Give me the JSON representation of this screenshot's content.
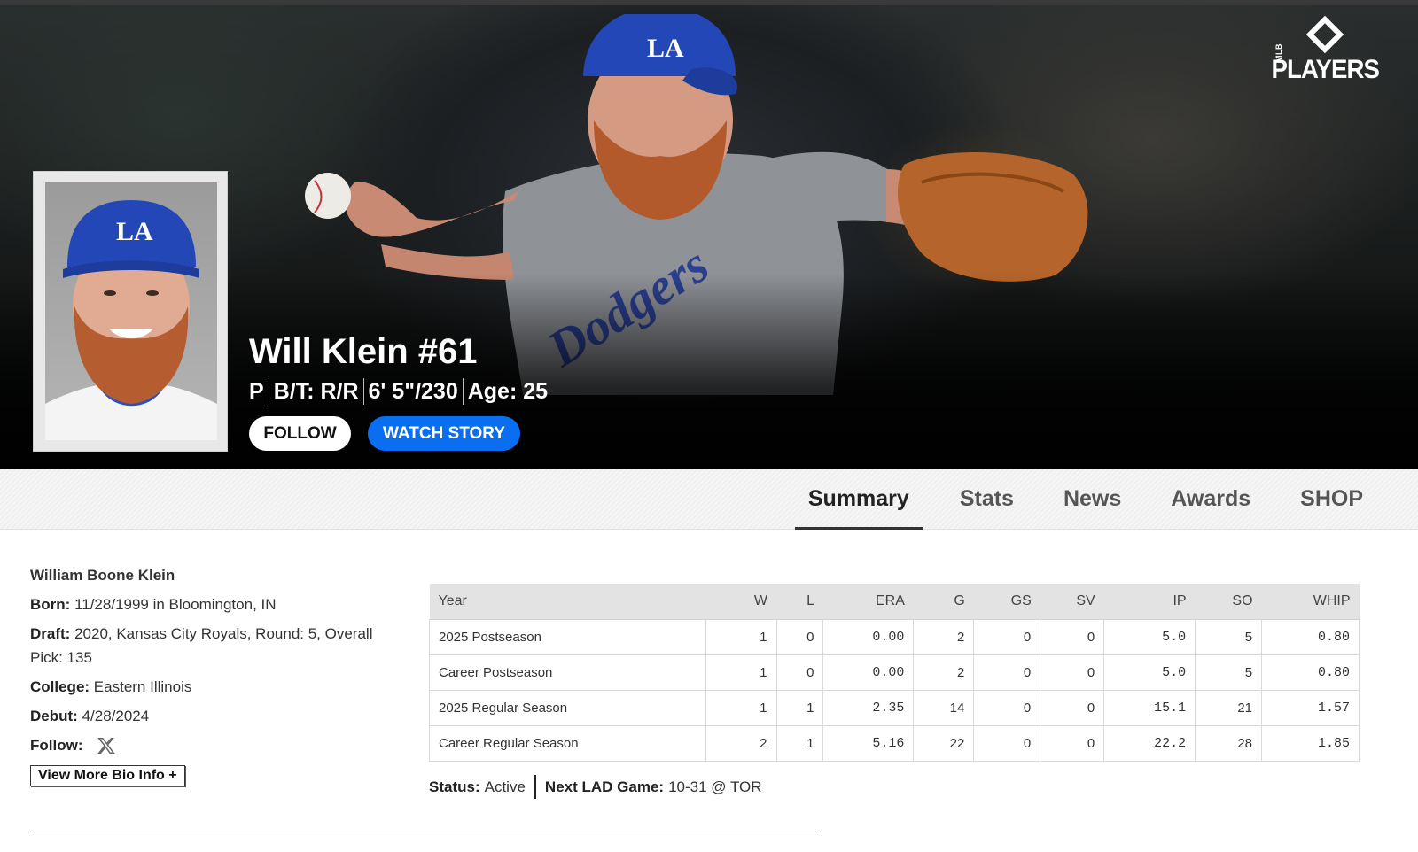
{
  "brand": {
    "logo_text": "PLAYERS",
    "logo_small": "MLB"
  },
  "player": {
    "name": "Will Klein #61",
    "position": "P",
    "bats_throws": "B/T: R/R",
    "height_weight": "6' 5\"/230",
    "age": "Age: 25"
  },
  "buttons": {
    "follow": "FOLLOW",
    "watch_story": "WATCH STORY"
  },
  "nav": {
    "tabs": [
      "Summary",
      "Stats",
      "News",
      "Awards",
      "SHOP"
    ],
    "active": "Summary"
  },
  "bio": {
    "full_name": "William Boone Klein",
    "born_label": "Born:",
    "born_value": "11/28/1999 in Bloomington, IN",
    "draft_label": "Draft:",
    "draft_value": "2020, Kansas City Royals, Round: 5, Overall Pick: 135",
    "college_label": "College:",
    "college_value": "Eastern Illinois",
    "debut_label": "Debut:",
    "debut_value": "4/28/2024",
    "follow_label": "Follow:",
    "more_button": "View More Bio Info +"
  },
  "stats": {
    "headers": [
      "Year",
      "W",
      "L",
      "ERA",
      "G",
      "GS",
      "SV",
      "IP",
      "SO",
      "WHIP"
    ],
    "rows": [
      [
        "2025 Postseason",
        "1",
        "0",
        "0.00",
        "2",
        "0",
        "0",
        "5.0",
        "5",
        "0.80"
      ],
      [
        "Career Postseason",
        "1",
        "0",
        "0.00",
        "2",
        "0",
        "0",
        "5.0",
        "5",
        "0.80"
      ],
      [
        "2025 Regular Season",
        "1",
        "1",
        "2.35",
        "14",
        "0",
        "0",
        "15.1",
        "21",
        "1.57"
      ],
      [
        "Career Regular Season",
        "2",
        "1",
        "5.16",
        "22",
        "0",
        "0",
        "22.2",
        "28",
        "1.85"
      ]
    ]
  },
  "status": {
    "status_label": "Status:",
    "status_value": "Active",
    "next_game_label": "Next LAD Game:",
    "next_game_value": "10-31 @ TOR"
  },
  "colors": {
    "accent_blue": "#0a6ef0",
    "dodger_blue": "#1f4fbf",
    "hero_dark": "#111111"
  },
  "icons": [
    "brand-logo",
    "x-social-icon"
  ]
}
